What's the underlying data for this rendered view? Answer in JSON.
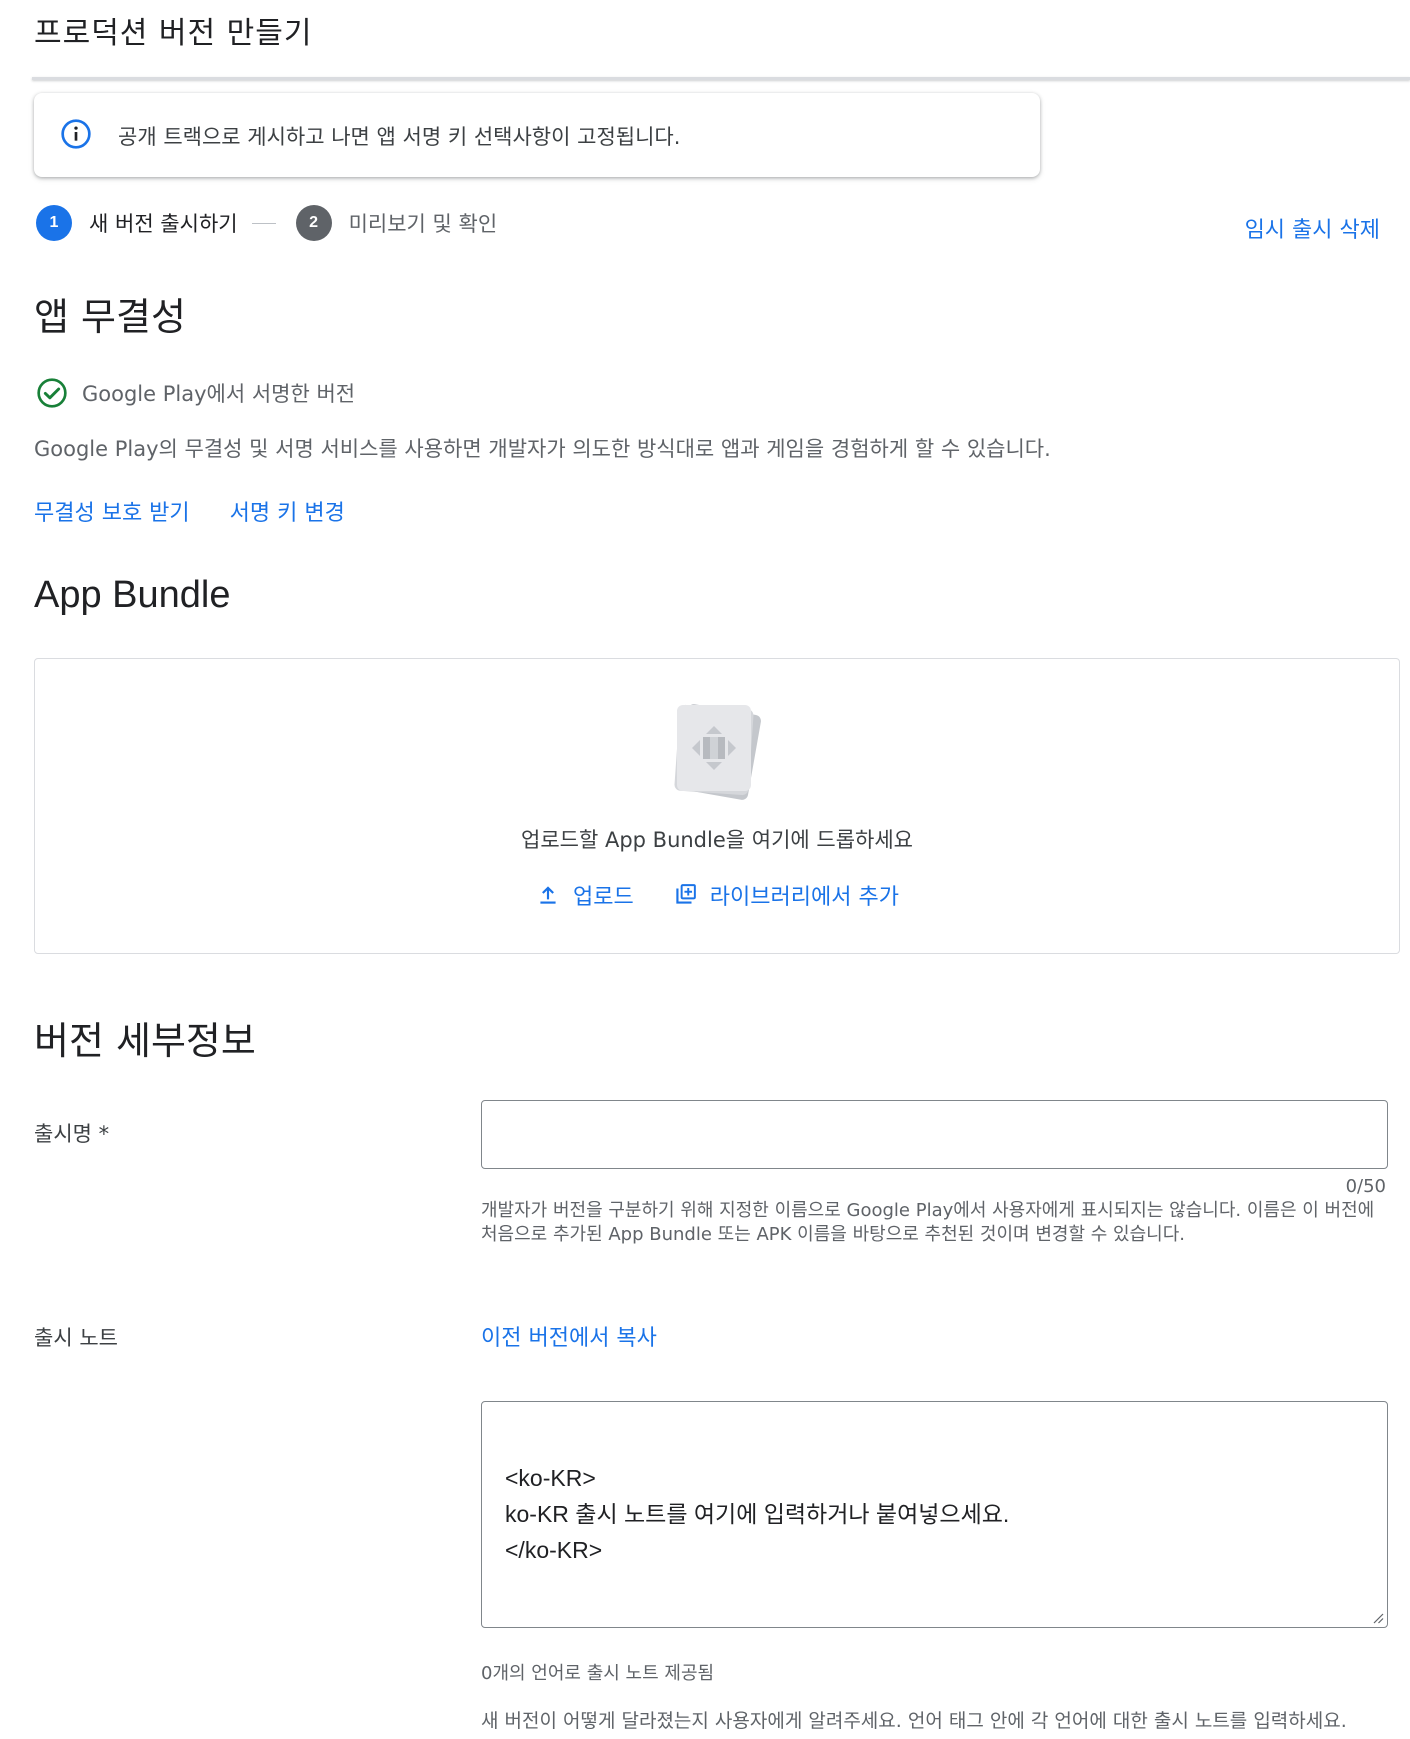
{
  "header": {
    "title": "프로덕션 버전 만들기"
  },
  "banner": {
    "text": "공개 트랙으로 게시하고 나면 앱 서명 키 선택사항이 고정됩니다."
  },
  "stepper": {
    "steps": [
      {
        "number": "1",
        "label": "새 버전 출시하기"
      },
      {
        "number": "2",
        "label": "미리보기 및 확인"
      }
    ]
  },
  "actions": {
    "discard_label": "임시 출시 삭제"
  },
  "integrity": {
    "title": "앱 무결성",
    "status": "Google Play에서 서명한 버전",
    "description": "Google Play의 무결성 및 서명 서비스를 사용하면 개발자가 의도한 방식대로 앱과 게임을 경험하게 할 수 있습니다.",
    "links": {
      "protect": "무결성 보호 받기",
      "change_key": "서명 키 변경"
    }
  },
  "bundle": {
    "title": "App Bundle",
    "drop_text": "업로드할 App Bundle을 여기에 드롭하세요",
    "upload_label": "업로드",
    "library_label": "라이브러리에서 추가"
  },
  "details": {
    "title": "버전 세부정보",
    "release_name": {
      "label": "출시명 *",
      "value": "",
      "counter": "0/50",
      "helper": "개발자가 버전을 구분하기 위해 지정한 이름으로 Google Play에서 사용자에게 표시되지는 않습니다. 이름은 이 버전에 처음으로 추가된 App Bundle 또는 APK 이름을 바탕으로 추천된 것이며 변경할 수 있습니다."
    },
    "release_notes": {
      "label": "출시 노트",
      "copy_label": "이전 버전에서 복사",
      "value": "<ko-KR>\nko-KR 출시 노트를 여기에 입력하거나 붙여넣으세요.\n</ko-KR>",
      "language_count": "0개의 언어로 출시 노트 제공됨",
      "hint": "새 버전이 어떻게 달라졌는지 사용자에게 알려주세요. 언어 태그 안에 각 언어에 대한 출시 노트를 입력하세요."
    }
  },
  "colors": {
    "accent": "#1a73e8",
    "success": "#188038",
    "muted": "#5f6368"
  }
}
